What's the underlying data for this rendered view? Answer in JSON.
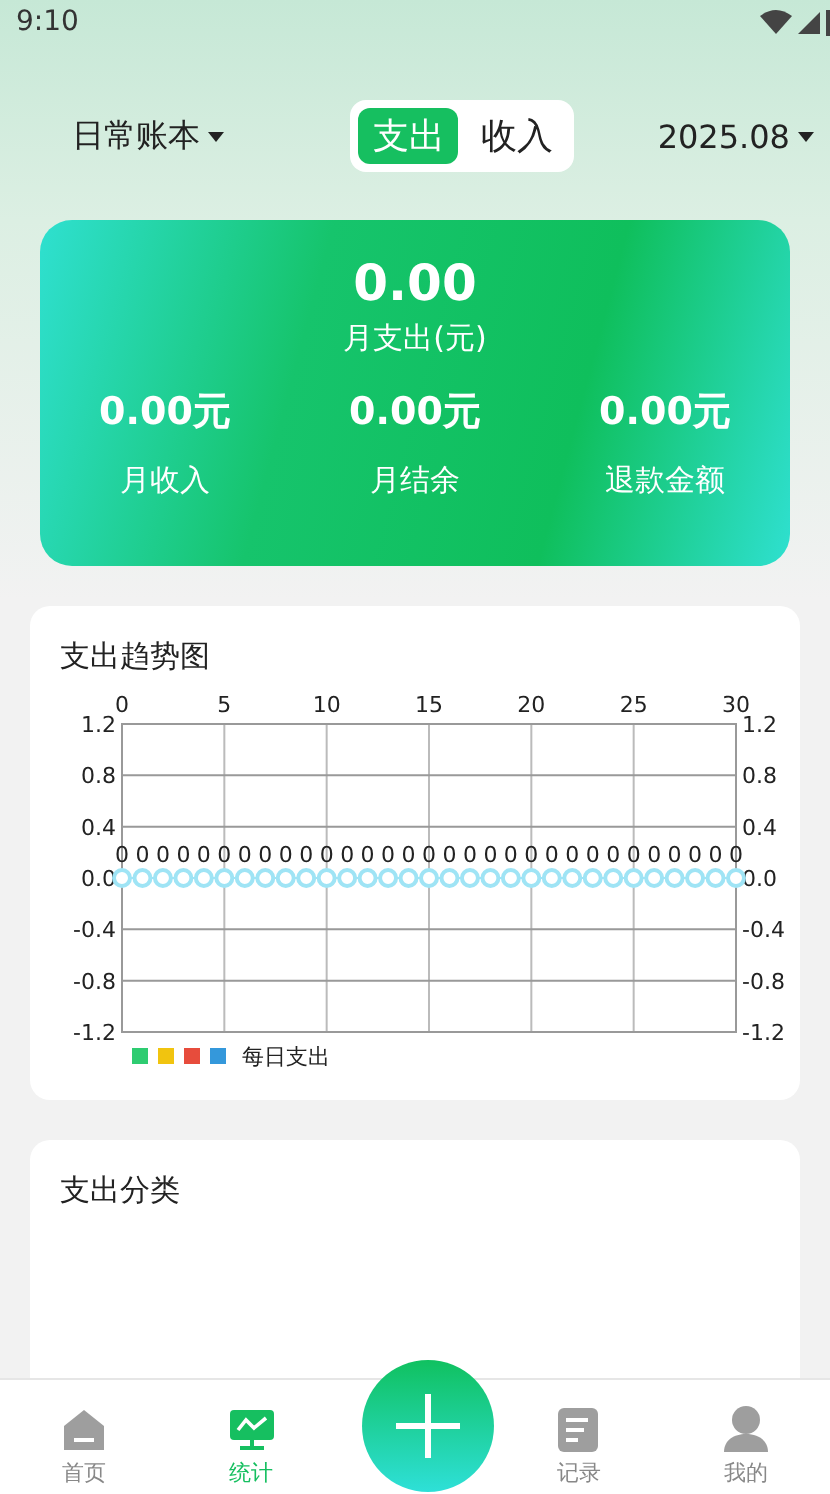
{
  "status_bar": {
    "time": "9:10"
  },
  "header": {
    "book": "日常账本",
    "tabs": [
      {
        "label": "支出",
        "selected": true
      },
      {
        "label": "收入",
        "selected": false
      }
    ],
    "month": "2025.08"
  },
  "summary": {
    "main_value": "0.00",
    "main_label": "月支出(元)",
    "stats": [
      {
        "value": "0.00元",
        "label": "月收入"
      },
      {
        "value": "0.00元",
        "label": "月结余"
      },
      {
        "value": "0.00元",
        "label": "退款金额"
      }
    ]
  },
  "trend": {
    "title": "支出趋势图",
    "chart_data": {
      "type": "line",
      "x": [
        0,
        1,
        2,
        3,
        4,
        5,
        6,
        7,
        8,
        9,
        10,
        11,
        12,
        13,
        14,
        15,
        16,
        17,
        18,
        19,
        20,
        21,
        22,
        23,
        24,
        25,
        26,
        27,
        28,
        29,
        30
      ],
      "series": [
        {
          "name": "每日支出",
          "color": "#9fe4f5",
          "marker": "circle",
          "values": [
            0,
            0,
            0,
            0,
            0,
            0,
            0,
            0,
            0,
            0,
            0,
            0,
            0,
            0,
            0,
            0,
            0,
            0,
            0,
            0,
            0,
            0,
            0,
            0,
            0,
            0,
            0,
            0,
            0,
            0,
            0
          ]
        }
      ],
      "xlim": [
        0,
        30
      ],
      "ylim": [
        -1.2,
        1.2
      ],
      "xticks": [
        0,
        5,
        10,
        15,
        20,
        25,
        30
      ],
      "yticks": [
        {
          "value": 1.2,
          "label": "1.2"
        },
        {
          "value": 0.8,
          "label": "0.8"
        },
        {
          "value": 0.4,
          "label": "0.4"
        },
        {
          "value": 0,
          "label": "0.0"
        },
        {
          "value": -0.4,
          "label": "-0.4"
        },
        {
          "value": -0.8,
          "label": "-0.8"
        },
        {
          "value": -1.2,
          "label": "-1.2"
        }
      ],
      "y2ticks": [
        {
          "value": 1.2,
          "label": "1.2"
        },
        {
          "value": 0.8,
          "label": "0.8"
        },
        {
          "value": 0.4,
          "label": "0.4"
        },
        {
          "value": 0,
          "label": "0.0"
        },
        {
          "value": -0.4,
          "label": "-0.4"
        },
        {
          "value": -0.8,
          "label": "-0.8"
        },
        {
          "value": -1.2,
          "label": "-1.2"
        }
      ],
      "y2lim": [
        -1.2,
        1.2
      ],
      "grid": true,
      "data_labels": true
    }
  },
  "category": {
    "title": "支出分类"
  },
  "nav": [
    {
      "label": "首页",
      "kind": "home",
      "selected": false
    },
    {
      "label": "统计",
      "kind": "stats",
      "selected": true
    },
    {
      "label": "记录",
      "kind": "records",
      "selected": false
    },
    {
      "label": "我的",
      "kind": "profile",
      "selected": false
    }
  ]
}
